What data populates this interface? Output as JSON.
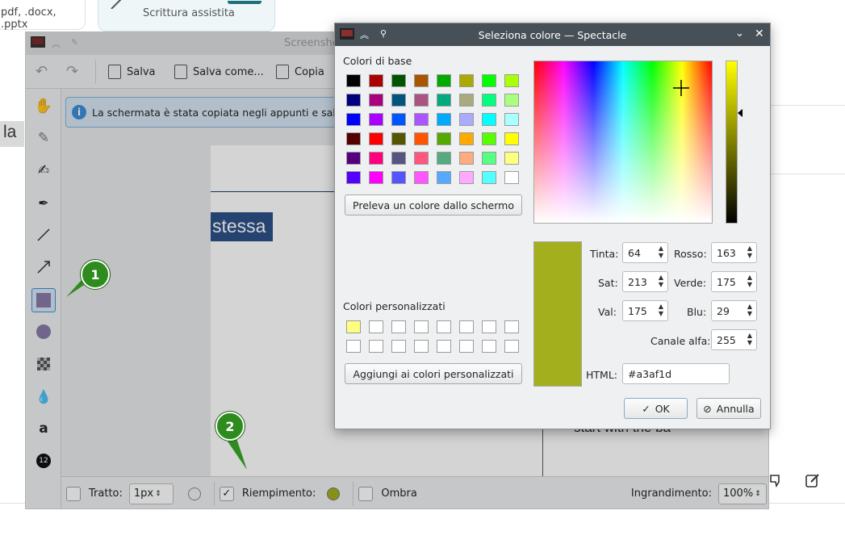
{
  "background": {
    "file_types": "pdf, .docx, .pptx",
    "card_subtitle": "Scrittura assistita",
    "fragment_la": "la"
  },
  "spectacle": {
    "title": "Screenshe",
    "toolbar": {
      "save": "Salva",
      "save_as": "Salva come...",
      "copy": "Copia"
    },
    "info_message": "La schermata è stata copiata negli appunti e salvata",
    "screenshot": {
      "selected_word": "stessa",
      "partial_text": "start with the ba"
    },
    "bottom": {
      "stroke_label": "Tratto:",
      "stroke_value": "1px",
      "fill_label": "Riempimento:",
      "fill_checked": true,
      "fill_color": "#a3af1d",
      "shadow_label": "Ombra",
      "zoom_label": "Ingrandimento:",
      "zoom_value": "100%"
    },
    "badges": [
      "1",
      "2"
    ]
  },
  "dialog": {
    "title": "Seleziona colore — Spectacle",
    "basic_colors_label": "Colori di base",
    "basic_colors": [
      [
        "#000000",
        "#aa0000",
        "#005500",
        "#aa5500",
        "#00aa00",
        "#aaaa00",
        "#00ff00",
        "#aaff00"
      ],
      [
        "#00007f",
        "#aa007f",
        "#00557f",
        "#aa557f",
        "#00aa7f",
        "#aaaa7f",
        "#00ff7f",
        "#aaff7f"
      ],
      [
        "#0000ff",
        "#aa00ff",
        "#0055ff",
        "#aa55ff",
        "#00aaff",
        "#aaaaff",
        "#00ffff",
        "#aaffff"
      ],
      [
        "#550000",
        "#ff0000",
        "#555500",
        "#ff5500",
        "#55aa00",
        "#ffaa00",
        "#55ff00",
        "#ffff00"
      ],
      [
        "#55007f",
        "#ff007f",
        "#55557f",
        "#ff557f",
        "#55aa7f",
        "#ffaa7f",
        "#55ff7f",
        "#ffff7f"
      ],
      [
        "#5500ff",
        "#ff00ff",
        "#5555ff",
        "#ff55ff",
        "#55aaff",
        "#ffaaff",
        "#55ffff",
        "#ffffff"
      ]
    ],
    "pick_screen_button": "Preleva un colore dallo schermo",
    "custom_colors_label": "Colori personalizzati",
    "custom_colors": [
      "#ffff7f",
      "#ffffff",
      "#ffffff",
      "#ffffff",
      "#ffffff",
      "#ffffff",
      "#ffffff",
      "#ffffff",
      "#ffffff",
      "#ffffff",
      "#ffffff",
      "#ffffff",
      "#ffffff",
      "#ffffff",
      "#ffffff",
      "#ffffff"
    ],
    "add_custom_button": "Aggiungi ai colori personalizzati",
    "fields": {
      "hue_label": "Tinta:",
      "hue": "64",
      "sat_label": "Sat:",
      "sat": "213",
      "val_label": "Val:",
      "val": "175",
      "red_label": "Rosso:",
      "red": "163",
      "green_label": "Verde:",
      "green": "175",
      "blue_label": "Blu:",
      "blue": "29",
      "alpha_label": "Canale alfa:",
      "alpha": "255",
      "html_label": "HTML:",
      "html": "#a3af1d"
    },
    "current_color": "#a3af1d",
    "ok_button": "OK",
    "cancel_button": "Annulla"
  }
}
